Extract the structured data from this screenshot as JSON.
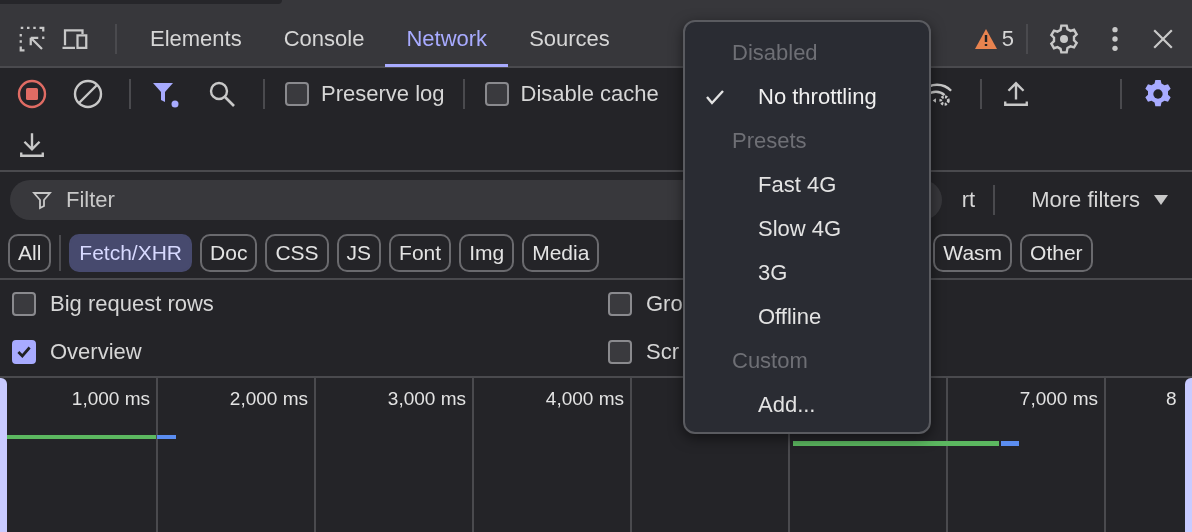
{
  "tabs": [
    {
      "label": "Elements",
      "selected": false
    },
    {
      "label": "Console",
      "selected": false
    },
    {
      "label": "Network",
      "selected": true
    },
    {
      "label": "Sources",
      "selected": false
    }
  ],
  "issues": {
    "count": "5"
  },
  "toolbar": {
    "recording": true,
    "filter_active": true,
    "checks": [
      {
        "label": "Preserve log",
        "checked": false
      },
      {
        "label": "Disable cache",
        "checked": false
      }
    ]
  },
  "filter": {
    "placeholder": "Filter",
    "hidden_option": "rt",
    "more": "More filters"
  },
  "chips": [
    {
      "label": "All",
      "selected": false
    },
    {
      "label": "Fetch/XHR",
      "selected": true
    },
    {
      "label": "Doc",
      "selected": false
    },
    {
      "label": "CSS",
      "selected": false
    },
    {
      "label": "JS",
      "selected": false
    },
    {
      "label": "Font",
      "selected": false
    },
    {
      "label": "Img",
      "selected": false
    },
    {
      "label": "Media",
      "selected": false
    },
    {
      "label": "Wasm",
      "selected": false
    },
    {
      "label": "Other",
      "selected": false
    }
  ],
  "settings_left": [
    {
      "label": "Big request rows",
      "checked": false
    },
    {
      "label": "Overview",
      "checked": true
    }
  ],
  "settings_right": [
    {
      "label": "Gro",
      "checked": false
    },
    {
      "label": "Scr",
      "checked": false
    }
  ],
  "timeline": {
    "ticks": [
      "1,000 ms",
      "2,000 ms",
      "3,000 ms",
      "4,000 ms",
      "7,000 ms",
      "8"
    ]
  },
  "throttling_menu": {
    "items": [
      {
        "kind": "header",
        "label": "Disabled"
      },
      {
        "kind": "option",
        "label": "No throttling",
        "selected": true
      },
      {
        "kind": "header",
        "label": "Presets"
      },
      {
        "kind": "option",
        "label": "Fast 4G",
        "selected": false
      },
      {
        "kind": "option",
        "label": "Slow 4G",
        "selected": false
      },
      {
        "kind": "option",
        "label": "3G",
        "selected": false
      },
      {
        "kind": "option",
        "label": "Offline",
        "selected": false
      },
      {
        "kind": "header",
        "label": "Custom"
      },
      {
        "kind": "option",
        "label": "Add...",
        "selected": false
      }
    ]
  }
}
